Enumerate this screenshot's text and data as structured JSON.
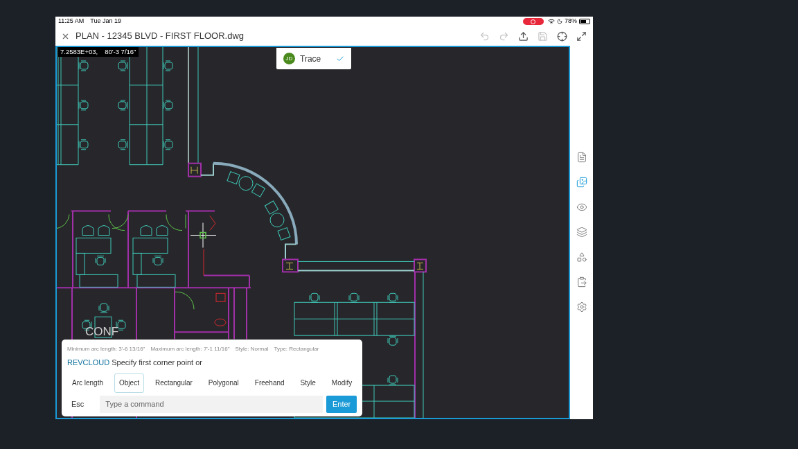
{
  "status_bar": {
    "time": "11:25 AM",
    "date": "Tue Jan 19",
    "recording": true,
    "battery": "78%"
  },
  "title_bar": {
    "title": "PLAN - 12345 BLVD - FIRST FLOOR.dwg",
    "tools": [
      {
        "kind": "undo",
        "disabled": true
      },
      {
        "kind": "redo",
        "disabled": true
      },
      {
        "kind": "upload",
        "disabled": false
      },
      {
        "kind": "save",
        "disabled": true
      },
      {
        "kind": "measure",
        "disabled": false
      },
      {
        "kind": "fullscreen",
        "disabled": false
      }
    ]
  },
  "coordinates": [
    "7.2583E+03,",
    "80'-3 7/16\""
  ],
  "trace": {
    "avatar": "JD",
    "label": "Trace",
    "checked": true
  },
  "room_label": "CONF",
  "command_panel": {
    "info": [
      "Minimum arc length: 3'-6 13/16\"",
      "Maximum arc length: 7'-1 11/16\"",
      "Style: Normal",
      "Type: Rectangular"
    ],
    "command": "REVCLOUD",
    "prompt": "Specify first corner point or",
    "options": [
      {
        "label": "Arc length",
        "selected": false
      },
      {
        "label": "Object",
        "selected": true
      },
      {
        "label": "Rectangular",
        "selected": false
      },
      {
        "label": "Polygonal",
        "selected": false
      },
      {
        "label": "Freehand",
        "selected": false
      },
      {
        "label": "Style",
        "selected": false
      },
      {
        "label": "Modify",
        "selected": false
      }
    ],
    "esc": "Esc",
    "input": {
      "placeholder": "Type a command"
    },
    "enter": "Enter"
  },
  "side_tools": [
    {
      "kind": "properties",
      "selected": false
    },
    {
      "kind": "images",
      "selected": true
    },
    {
      "kind": "view",
      "selected": false
    },
    {
      "kind": "layers",
      "selected": false
    },
    {
      "kind": "shapes",
      "selected": false
    },
    {
      "kind": "paste",
      "selected": false
    },
    {
      "kind": "settings",
      "selected": false
    }
  ]
}
